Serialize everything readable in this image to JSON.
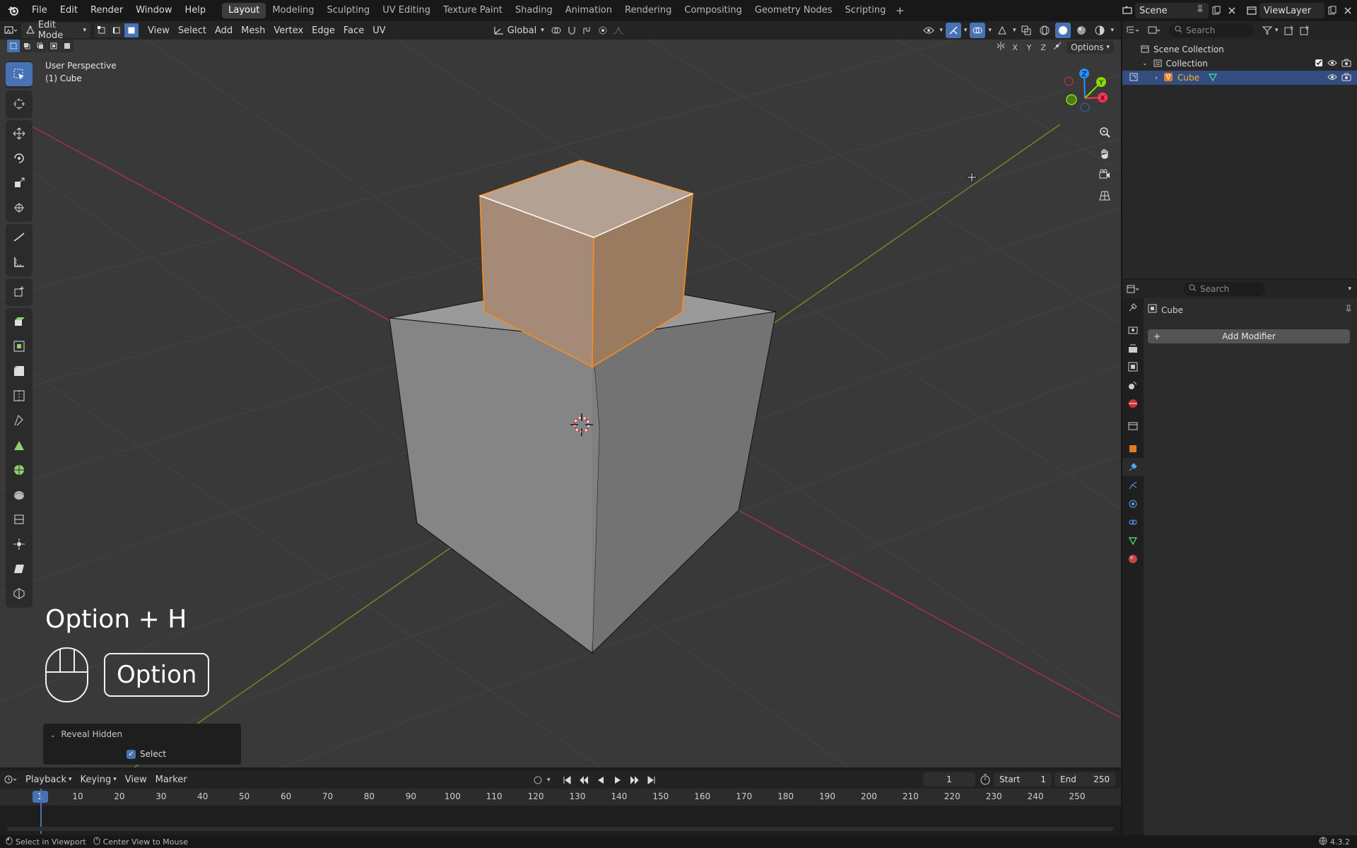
{
  "menubar": {
    "menus": [
      "File",
      "Edit",
      "Render",
      "Window",
      "Help"
    ],
    "workspaces": [
      "Layout",
      "Modeling",
      "Sculpting",
      "UV Editing",
      "Texture Paint",
      "Shading",
      "Animation",
      "Rendering",
      "Compositing",
      "Geometry Nodes",
      "Scripting"
    ],
    "active_workspace": "Layout",
    "scene_name": "Scene",
    "view_layer": "ViewLayer"
  },
  "viewport_header": {
    "mode": "Edit Mode",
    "menus": [
      "View",
      "Select",
      "Add",
      "Mesh",
      "Vertex",
      "Edge",
      "Face",
      "UV"
    ],
    "transform_orientation": "Global",
    "options_label": "Options",
    "axes": [
      "X",
      "Y",
      "Z"
    ]
  },
  "viewport": {
    "perspective_label": "User Perspective",
    "object_label": "(1) Cube",
    "shortcut_title": "Option + H",
    "shortcut_key": "Option",
    "gizmo": {
      "x": "X",
      "y": "Y",
      "z": "Z"
    }
  },
  "redo_panel": {
    "title": "Reveal Hidden",
    "select_label": "Select",
    "select_checked": true
  },
  "timeline": {
    "menus": [
      "Playback",
      "Keying",
      "View",
      "Marker"
    ],
    "current_frame": "1",
    "start_label": "Start",
    "start_value": "1",
    "end_label": "End",
    "end_value": "250",
    "ruler_ticks": [
      "1",
      "10",
      "20",
      "30",
      "40",
      "50",
      "60",
      "70",
      "80",
      "90",
      "100",
      "110",
      "120",
      "130",
      "140",
      "150",
      "160",
      "170",
      "180",
      "190",
      "200",
      "210",
      "220",
      "230",
      "240",
      "250"
    ]
  },
  "statusbar": {
    "left_hint": "Select in Viewport",
    "mid_hint": "Center View to Mouse",
    "version": "4.3.2"
  },
  "outliner": {
    "search_placeholder": "Search",
    "rows": [
      {
        "label": "Scene Collection"
      },
      {
        "label": "Collection"
      },
      {
        "label": "Cube"
      }
    ]
  },
  "properties": {
    "search_placeholder": "Search",
    "object_name": "Cube",
    "add_modifier_label": "Add Modifier"
  },
  "colors": {
    "accent": "#4772b3",
    "selection_orange": "#ff8c1a",
    "x_axis": "#ff3352",
    "y_axis": "#8bdc00",
    "z_axis": "#2890ff"
  }
}
